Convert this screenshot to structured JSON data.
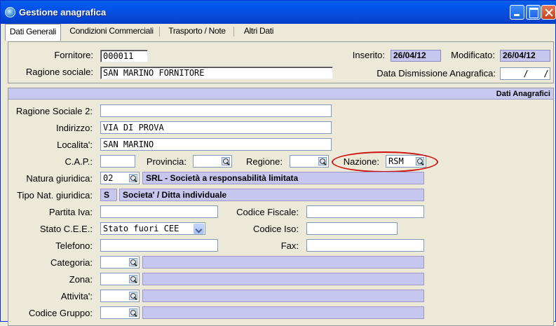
{
  "window": {
    "title": "Gestione anagrafica"
  },
  "tabs": [
    {
      "label": "Dati Generali"
    },
    {
      "label": "Condizioni Commerciali"
    },
    {
      "label": "Trasporto / Note"
    },
    {
      "label": "Altri Dati"
    }
  ],
  "header": {
    "fornitore_label": "Fornitore:",
    "fornitore_value": "000011",
    "ragione_label": "Ragione sociale:",
    "ragione_value": "SAN MARINO FORNITORE",
    "inserito_label": "Inserito:",
    "inserito_value": "26/04/12",
    "modificato_label": "Modificato:",
    "modificato_value": "26/04/12",
    "dismissione_label": "Data Dismissione Anagrafica:",
    "dismissione_value": "  /   /"
  },
  "section": {
    "title": "Dati Anagrafici"
  },
  "form": {
    "ragione2_label": "Ragione Sociale 2:",
    "ragione2_value": "",
    "indirizzo_label": "Indirizzo:",
    "indirizzo_value": "VIA DI PROVA",
    "localita_label": "Localita':",
    "localita_value": "SAN MARINO",
    "cap_label": "C.A.P.:",
    "cap_value": "",
    "provincia_label": "Provincia:",
    "provincia_value": "",
    "regione_label": "Regione:",
    "regione_value": "",
    "nazione_label": "Nazione:",
    "nazione_value": "RSM",
    "natura_label": "Natura giuridica:",
    "natura_code": "02",
    "natura_desc": "SRL - Società a responsabilità limitata",
    "tiponat_label": "Tipo Nat. giuridica:",
    "tiponat_code": "S",
    "tiponat_desc": "Societa' / Ditta individuale",
    "piva_label": "Partita Iva:",
    "piva_value": "",
    "cf_label": "Codice Fiscale:",
    "cf_value": "",
    "statocee_label": "Stato C.E.E.:",
    "statocee_value": "Stato fuori CEE",
    "codiso_label": "Codice Iso:",
    "codiso_value": "",
    "telefono_label": "Telefono:",
    "telefono_value": "",
    "fax_label": "Fax:",
    "fax_value": "",
    "categoria_label": "Categoria:",
    "categoria_value": "",
    "zona_label": "Zona:",
    "zona_value": "",
    "attivita_label": "Attivita':",
    "attivita_value": "",
    "gruppo_label": "Codice Gruppo:",
    "gruppo_value": ""
  },
  "colors": {
    "titlebar": "#0058ee",
    "readonly": "#c6c6ee",
    "highlight": "#d01010"
  }
}
